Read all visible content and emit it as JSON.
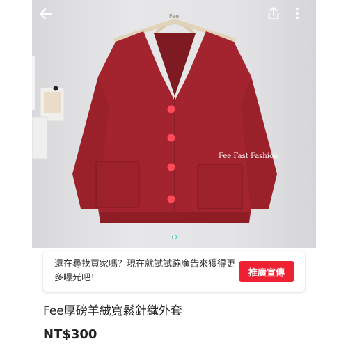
{
  "product_photo": {
    "alt": "",
    "watermark_text": "Fee Fast Fashion",
    "hanger_text": "Fee",
    "carousel_dots": 1
  },
  "header": {
    "back_icon": "back-arrow-icon",
    "share_icon": "share-icon",
    "more_icon": "more-vertical-icon"
  },
  "promo": {
    "text": "還在尋找買家嗎？現在就試試蹦廣告來獲得更多曝光吧！",
    "button_label": "推廣宣傳",
    "button_color": "#ef2233"
  },
  "listing": {
    "title": "Fee厚磅羊絨寬鬆針織外套",
    "price": "NT$300"
  },
  "colors": {
    "cardigan": "#a3242e",
    "button_red": "#ef2233"
  }
}
